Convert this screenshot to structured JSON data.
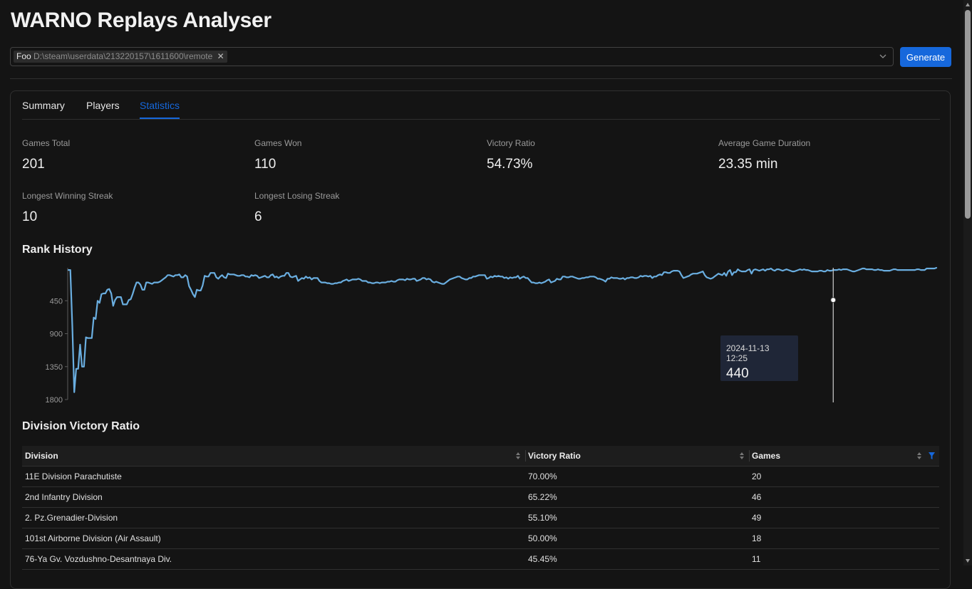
{
  "app": {
    "title": "WARNO Replays Analyser"
  },
  "toolbar": {
    "tag_name": "Foo",
    "tag_path": "D:\\steam\\userdata\\213220157\\1611600\\remote",
    "generate_label": "Generate"
  },
  "tabs": [
    {
      "label": "Summary",
      "active": false
    },
    {
      "label": "Players",
      "active": false
    },
    {
      "label": "Statistics",
      "active": true
    }
  ],
  "stats": [
    {
      "label": "Games Total",
      "value": "201"
    },
    {
      "label": "Games Won",
      "value": "110"
    },
    {
      "label": "Victory Ratio",
      "value": "54.73%"
    },
    {
      "label": "Average Game Duration",
      "value": "23.35 min"
    },
    {
      "label": "Longest Winning Streak",
      "value": "10"
    },
    {
      "label": "Longest Losing Streak",
      "value": "6"
    }
  ],
  "rank_history": {
    "title": "Rank History",
    "tooltip": {
      "date": "2024-11-13 12:25",
      "value": "440"
    }
  },
  "chart_data": {
    "type": "line",
    "title": "Rank History",
    "ylim": [
      1800,
      0
    ],
    "y_inverted": true,
    "y_ticks": [
      "450",
      "900",
      "1350",
      "1800"
    ],
    "grid": false,
    "series": [
      {
        "color": "#6aaee0",
        "values": [
          30,
          30,
          800,
          1700,
          1380,
          1380,
          1050,
          1350,
          1350,
          950,
          960,
          960,
          960,
          680,
          700,
          450,
          480,
          360,
          350,
          350,
          300,
          290,
          350,
          520,
          440,
          400,
          400,
          400,
          500,
          500,
          500,
          440,
          430,
          360,
          270,
          200,
          200,
          230,
          300,
          300,
          200,
          200,
          210,
          220,
          200,
          200,
          200,
          190,
          170,
          150,
          130,
          100,
          100,
          110,
          120,
          100,
          100,
          90,
          130,
          130,
          100,
          120,
          250,
          300,
          360,
          400,
          300,
          310,
          310,
          240,
          110,
          120,
          120,
          70,
          70,
          70,
          130,
          150,
          120,
          100,
          130,
          140,
          80,
          90,
          90,
          90,
          100,
          110,
          110,
          100,
          100,
          120,
          120,
          130,
          100,
          110,
          100,
          110,
          140,
          130,
          120,
          110,
          130,
          130,
          100,
          90,
          130,
          120,
          140,
          120,
          110,
          110,
          70,
          70,
          120,
          130,
          120,
          110,
          180,
          160,
          140,
          150,
          120,
          140,
          130,
          160,
          140,
          140,
          140,
          180,
          200,
          200,
          200,
          210,
          210,
          220,
          220,
          210,
          210,
          200,
          200,
          180,
          170,
          160,
          180,
          170,
          160,
          160,
          160,
          150,
          160,
          180,
          180,
          180,
          200,
          200,
          210,
          210,
          200,
          200,
          210,
          200,
          200,
          200,
          190,
          190,
          180,
          190,
          190,
          170,
          160,
          160,
          160,
          170,
          150,
          160,
          160,
          150,
          150,
          180,
          170,
          160,
          140,
          140,
          160,
          150,
          160,
          190,
          200,
          190,
          200,
          210,
          220,
          220,
          200,
          180,
          160,
          150,
          140,
          130,
          120,
          120,
          140,
          150,
          160,
          160,
          140,
          140,
          120,
          120,
          110,
          100,
          100,
          100,
          100,
          150,
          140,
          120,
          130,
          110,
          120,
          110,
          120,
          120,
          140,
          130,
          150,
          130,
          140,
          130,
          130,
          110,
          150,
          130,
          120,
          140,
          140,
          170,
          200,
          200,
          210,
          210,
          200,
          210,
          200,
          190,
          170,
          160,
          200,
          190,
          180,
          150,
          160,
          160,
          120,
          120,
          130,
          130,
          120,
          120,
          130,
          140,
          150,
          150,
          140,
          140,
          130,
          130,
          120,
          120,
          120,
          130,
          150,
          150,
          160,
          170,
          190,
          150,
          150,
          130,
          140,
          140,
          140,
          150,
          150,
          140,
          160,
          140,
          140,
          130,
          130,
          140,
          140,
          130,
          110,
          120,
          110,
          110,
          120,
          110,
          140,
          120,
          120,
          100,
          90,
          100,
          60,
          60,
          70,
          70,
          50,
          40,
          40,
          40,
          50,
          100,
          140,
          130,
          120,
          110,
          90,
          80,
          80,
          80,
          70,
          60,
          50,
          100,
          130,
          140,
          150,
          140,
          120,
          100,
          80,
          90,
          100,
          70,
          110,
          50,
          30,
          100,
          60,
          60,
          20,
          40,
          50,
          50,
          50,
          30,
          20,
          80,
          30,
          20,
          30,
          40,
          30,
          20,
          40,
          20,
          20,
          10,
          30,
          40,
          20,
          20,
          30,
          40,
          30,
          20,
          30,
          40,
          50,
          50,
          40,
          30,
          20,
          30,
          20,
          30,
          30,
          40,
          50,
          50,
          50,
          50,
          40,
          40,
          50,
          50,
          30,
          40,
          40,
          30,
          30,
          30,
          20,
          30,
          20,
          20,
          20,
          30,
          40,
          50,
          50,
          40,
          30,
          20,
          10,
          10,
          20,
          20,
          20,
          20,
          30,
          30,
          20,
          30,
          30,
          40,
          40,
          40,
          40,
          30,
          20,
          20,
          30,
          30,
          30,
          30,
          30,
          30,
          30,
          30,
          30,
          30,
          20,
          20,
          30,
          30,
          30,
          10,
          10,
          10,
          10,
          10,
          0
        ]
      }
    ],
    "highlight": {
      "date": "2024-11-13 12:25",
      "value": 440
    }
  },
  "division_table": {
    "title": "Division Victory Ratio",
    "columns": [
      "Division",
      "Victory Ratio",
      "Games"
    ],
    "rows": [
      [
        "11E Division Parachutiste",
        "70.00%",
        "20"
      ],
      [
        "2nd Infantry Division",
        "65.22%",
        "46"
      ],
      [
        "2. Pz.Grenadier-Division",
        "55.10%",
        "49"
      ],
      [
        "101st Airborne Division (Air Assault)",
        "50.00%",
        "18"
      ],
      [
        "76-Ya Gv. Vozdushno-Desantnaya Div.",
        "45.45%",
        "11"
      ]
    ]
  },
  "colors": {
    "accent": "#1668dc",
    "line": "#6aaee0",
    "background": "#141414",
    "tooltip": "#1f2637"
  },
  "icons": {
    "chevron": "chevron-down-icon",
    "close": "close-icon",
    "sort": "sort-icon",
    "filter": "filter-icon"
  }
}
